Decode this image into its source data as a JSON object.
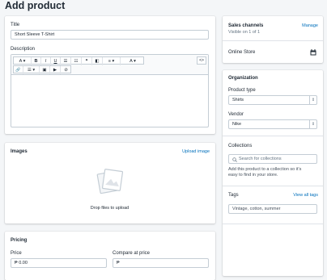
{
  "page": {
    "title": "Add product"
  },
  "general": {
    "title_label": "Title",
    "title_value": "Short Sleeve T-Shirt",
    "description_label": "Description",
    "toolbar_row1": [
      "A ▾",
      "B",
      "I",
      "U",
      "☰",
      "☷",
      "❝",
      "◧",
      "≡ ▾",
      "A ▾",
      "<>"
    ],
    "toolbar_row2": [
      "🔗",
      "☰ ▾",
      "▣",
      "▶",
      "⊘"
    ]
  },
  "images": {
    "heading": "Images",
    "upload_link": "Upload image",
    "drop_text": "Drop files to upload"
  },
  "pricing": {
    "heading": "Pricing",
    "price_label": "Price",
    "price_value": "₱ 0.00",
    "compare_label": "Compare at price",
    "compare_value": "₱"
  },
  "sales_channels": {
    "heading": "Sales channels",
    "manage_link": "Manage",
    "subtitle": "Visible on 1 of 1",
    "channel": "Online Store"
  },
  "organization": {
    "heading": "Organization",
    "product_type_label": "Product type",
    "product_type_value": "Shirts",
    "vendor_label": "Vendor",
    "vendor_value": "Nike"
  },
  "collections": {
    "heading": "Collections",
    "search_placeholder": "Search for collections",
    "help_text_line1": "Add this product to a collection so it's",
    "help_text_line2": "easy to find in your store."
  },
  "tags": {
    "heading": "Tags",
    "view_all_link": "View all tags",
    "placeholder": "Vintage, cotton, summer"
  },
  "colors": {
    "link": "#006fbb",
    "background": "#f4f6f8"
  }
}
